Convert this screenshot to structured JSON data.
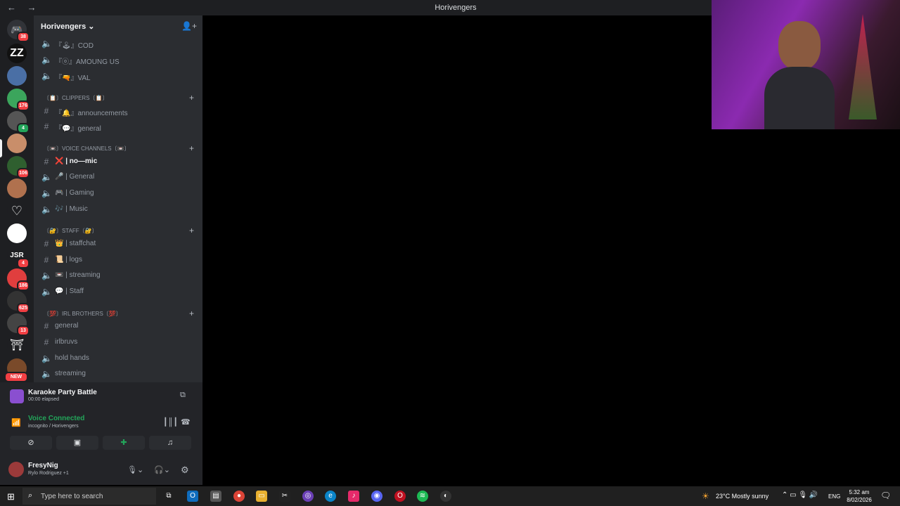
{
  "window": {
    "title": "Horivengers",
    "nav": "← →"
  },
  "server_rail": {
    "badges": [
      "38",
      "176",
      "4",
      "106",
      "4",
      "186",
      "625",
      "13",
      "NEW"
    ]
  },
  "server": {
    "name": "Horivengers ⌄"
  },
  "channels_top": [
    {
      "icon": "speaker-icon",
      "label": "『🕹』COD"
    },
    {
      "icon": "speaker-icon",
      "label": "『ⓞ』AMOUNG US"
    },
    {
      "icon": "speaker-icon",
      "label": "『🔫』VAL"
    }
  ],
  "categories": {
    "clippers": "〔📋〕CLIPPERS〔📋〕",
    "voice": "〔📼〕VOICE CHANNELS〔📼〕",
    "staff": "〔🔐〕STAFF〔🔐〕",
    "irl": "〔💯〕IRL BROTHERS〔💯〕"
  },
  "clippers_channels": [
    {
      "icon": "hash-icon",
      "label": "『🔔』announcements"
    },
    {
      "icon": "hash-icon",
      "label": "『💬』general"
    }
  ],
  "voice_channels": [
    {
      "icon": "hash-icon",
      "label": "❌ | no—mic",
      "active": true
    },
    {
      "icon": "speaker-icon",
      "label": "🎤 | General"
    },
    {
      "icon": "speaker-icon",
      "label": "🎮 | Gaming"
    },
    {
      "icon": "speaker-icon",
      "label": "🎶 | Music"
    }
  ],
  "staff_channels": [
    {
      "icon": "hash-icon",
      "label": "👑 | staffchat"
    },
    {
      "icon": "hash-icon",
      "label": "📜 | logs"
    },
    {
      "icon": "speaker-icon",
      "label": "📼 | streaming"
    },
    {
      "icon": "speaker-icon",
      "label": "💬 | Staff"
    }
  ],
  "irl_channels": [
    {
      "icon": "hash-icon",
      "label": "general"
    },
    {
      "icon": "hash-icon",
      "label": "irlbruvs"
    },
    {
      "icon": "speaker-icon",
      "label": "hold hands"
    },
    {
      "icon": "speaker-icon",
      "label": "streaming"
    }
  ],
  "activity": {
    "title": "Karaoke Party Battle",
    "elapsed": "00:00 elapsed"
  },
  "voice": {
    "status": "Voice Connected",
    "location": "incognito / Horivengers"
  },
  "user": {
    "name": "FresyNig",
    "status": "Rylo Rodriguez +1"
  },
  "taskbar": {
    "search_placeholder": "Type here to search",
    "weather": "23°C  Mostly sunny",
    "lang": "ENG",
    "time": "5:32 am",
    "date": "8/02/2026"
  },
  "colors": {
    "accent_green": "#23a55a",
    "sidebar": "#2b2d31",
    "rail": "#1e1f22",
    "badge_red": "#f23f43"
  }
}
